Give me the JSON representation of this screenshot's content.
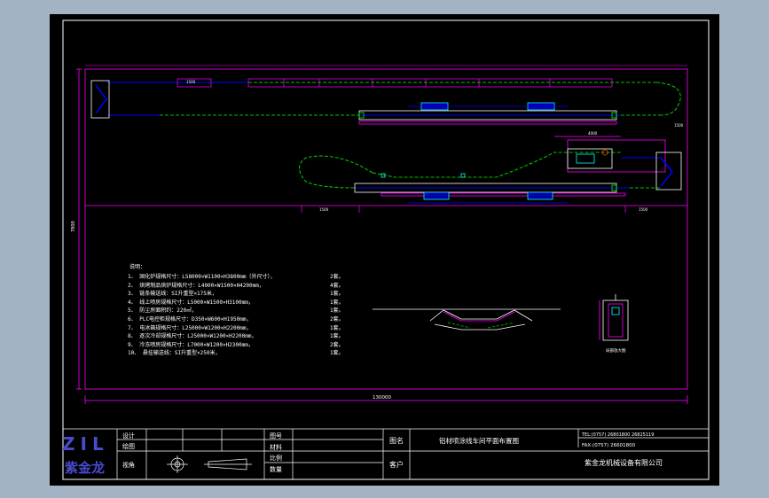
{
  "drawing": {
    "total_length": "130000",
    "dim_upper_a": "1500",
    "dim_lower_a": "1500",
    "dim_lower_b": "1500",
    "dim_box_top": "4000",
    "dim_vertical": "7800",
    "dim_right_small": "1500",
    "detail_label": "局部放大图"
  },
  "notes": {
    "title": "说明：",
    "items": [
      {
        "text": "1、 固化炉规格尺寸：L58000×W1100×H3800mm（外尺寸），",
        "qty": "2套。"
      },
      {
        "text": "2、 烘烤制品烘炉规格尺寸：L4000×W1500×H4200mm，",
        "qty": "4套。"
      },
      {
        "text": "3、 链条输送线：SI升重型×175米，",
        "qty": "1套。"
      },
      {
        "text": "4、 线上喷房规格尺寸：L5000×W1500×H3100mm，",
        "qty": "1套。"
      },
      {
        "text": "5、 防尘房面积约：220㎡，",
        "qty": "1套。"
      },
      {
        "text": "6、 PLC电控柜规格尺寸：D350×W600×H1950mm，",
        "qty": "2套。"
      },
      {
        "text": "7、 电冰箱规格尺寸：L25000×W1200×H2200mm，",
        "qty": "1套。"
      },
      {
        "text": "8、 逐次冷却规格尺寸：L25000×W1200×H2200mm，",
        "qty": "1套。"
      },
      {
        "text": "9、 冷冻喷房规格尺寸：L7000×W1200×H2300mm，",
        "qty": "2套。"
      },
      {
        "text": "10、 悬挂输送线：SI升重型×250米，",
        "qty": "1套。"
      }
    ]
  },
  "title_block": {
    "logo_mark": "ZIL",
    "logo_name": "紫金龙",
    "labels": {
      "design": "设计",
      "draw": "绘图",
      "view": "视角",
      "drawing_no": "图号",
      "material": "材料",
      "scale": "比例",
      "quantity": "数量",
      "drawing_name": "图名",
      "client": "客户"
    },
    "drawing_name_value": "铝材喷涂线车间平面布置图",
    "tel": "TEL:(0757) 26801800 26825119",
    "fax": "FAX:(0757) 26601800",
    "company": "紫金龙机械设备有限公司"
  },
  "colors": {
    "sheet": "#000000",
    "frame": "#ffffff",
    "conveyor_blue": "#0000ff",
    "conveyor_green": "#00c000",
    "wall_magenta": "#ff00ff",
    "equipment_cyan": "#00ffff",
    "accent_red": "#ff4000"
  }
}
